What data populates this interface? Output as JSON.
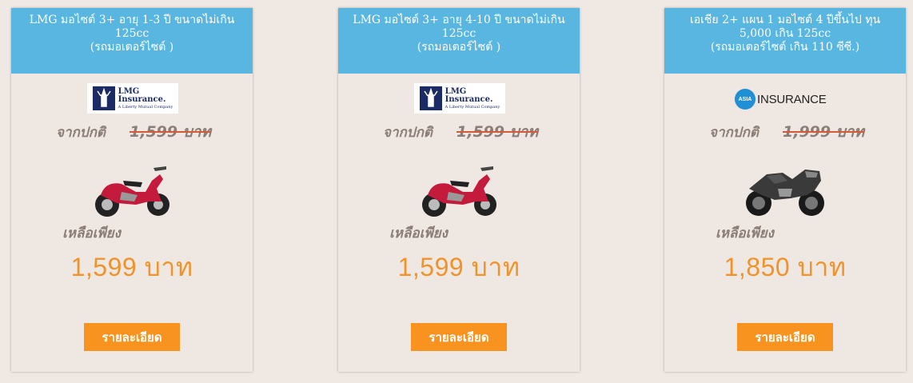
{
  "cards": [
    {
      "title_lines": [
        "LMG มอไซต์ 3+ อายุ 1-3 ปี ขนาดไม่เกิน",
        "125cc",
        "(รถมอเตอร์ไซต์ )"
      ],
      "logo": {
        "type": "lmg",
        "line1": "LMG",
        "line2": "Insurance.",
        "tagline": "A Liberty Mutual Company"
      },
      "normal_label": "จากปกติ",
      "normal_price": "1,599 บาท",
      "bike_icon": "scooter-motorcycle-red",
      "remain_label": "เหลือเพียง",
      "price": "1,599 บาท",
      "button_label": "รายละเอียด"
    },
    {
      "title_lines": [
        "LMG มอไซต์ 3+ อายุ 4-10 ปี ขนาดไม่เกิน",
        "125cc",
        "(รถมอเตอร์ไซต์ )"
      ],
      "logo": {
        "type": "lmg",
        "line1": "LMG",
        "line2": "Insurance.",
        "tagline": "A Liberty Mutual Company"
      },
      "normal_label": "จากปกติ",
      "normal_price": "1,599 บาท",
      "bike_icon": "scooter-motorcycle-red",
      "remain_label": "เหลือเพียง",
      "price": "1,599 บาท",
      "button_label": "รายละเอียด"
    },
    {
      "title_lines": [
        "เอเชีย 2+ แผน 1 มอไซต์ 4 ปีขึ้นไป ทุน",
        "5,000 เกิน 125cc",
        "(รถมอเตอร์ไซต์ เกิน 110 ซีซี.)"
      ],
      "logo": {
        "type": "asia",
        "badge": "ASIA",
        "word": "INSURANCE"
      },
      "normal_label": "จากปกติ",
      "normal_price": "1,999 บาท",
      "bike_icon": "sport-motorcycle-black",
      "remain_label": "เหลือเพียง",
      "price": "1,850 บาท",
      "button_label": "รายละเอียด"
    }
  ],
  "colors": {
    "background": "#f0e9e3",
    "header": "#58b6e0",
    "price": "#f0932b",
    "button": "#f7931e",
    "muted_text": "#8b7e76",
    "strike": "#d35a3b"
  }
}
